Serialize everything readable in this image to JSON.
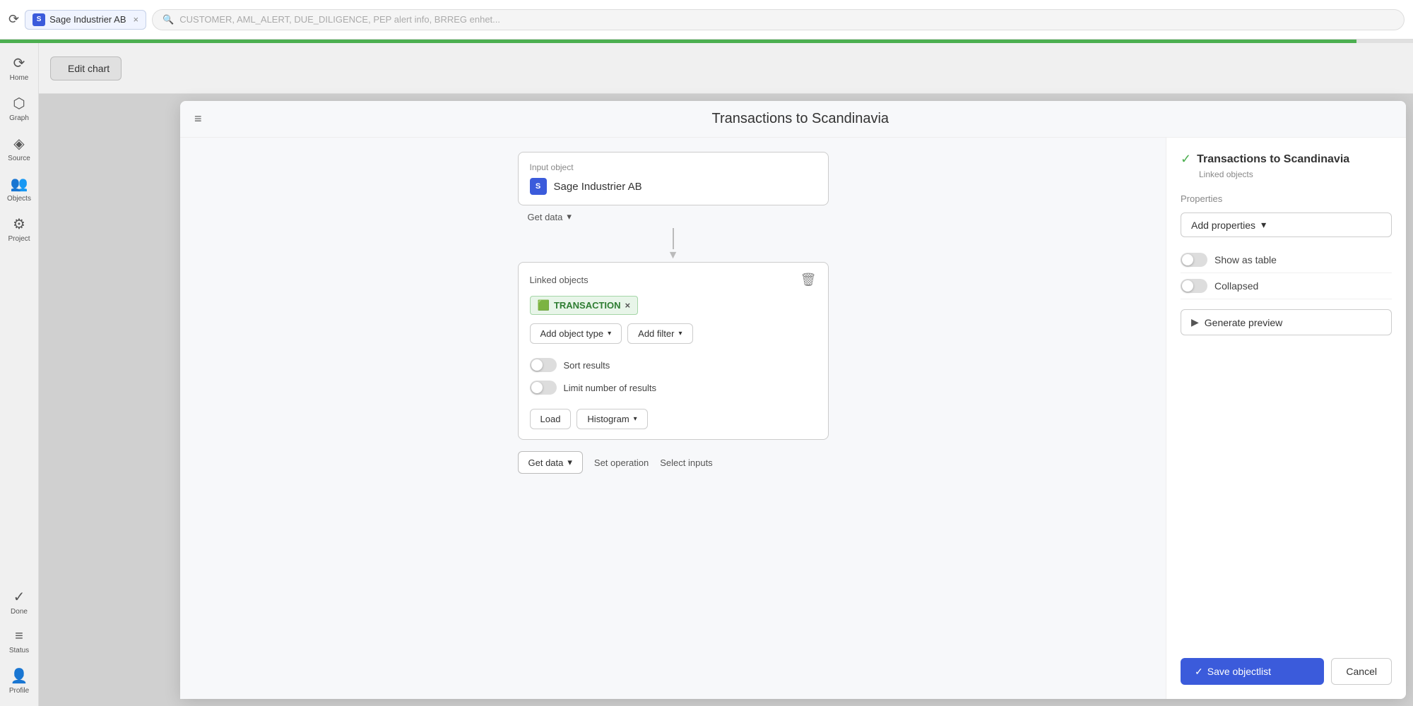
{
  "topbar": {
    "tab_title": "Sage Industrier AB",
    "tab_icon_text": "S",
    "search_placeholder": "CUSTOMER, AML_ALERT, DUE_DILIGENCE, PEP alert info, BRREG enhet..."
  },
  "sidebar": {
    "items": [
      {
        "id": "home",
        "label": "Home",
        "icon": "⟳"
      },
      {
        "id": "graph",
        "label": "Graph",
        "icon": "⬡"
      },
      {
        "id": "source",
        "label": "Source",
        "icon": "◈"
      },
      {
        "id": "objects",
        "label": "Objects",
        "icon": "👥"
      },
      {
        "id": "projects",
        "label": "Project",
        "icon": "⚙"
      },
      {
        "id": "done",
        "label": "Done",
        "icon": "✓"
      },
      {
        "id": "status",
        "label": "Status",
        "icon": "≡"
      },
      {
        "id": "profile",
        "label": "Profile",
        "icon": "👤"
      }
    ]
  },
  "edit_chart_bar": {
    "button_label": "Edit chart",
    "arrow_icon": "←"
  },
  "modal": {
    "title": "Transactions to Scandinavia",
    "menu_icon": "≡",
    "panel_title": "Transactions to Scandinavia",
    "panel_subtitle": "Linked objects",
    "properties_label": "Properties",
    "add_properties_label": "Add properties",
    "dropdown_arrow": "▾",
    "show_as_table_label": "Show as table",
    "collapsed_label": "Collapsed",
    "generate_preview_label": "Generate preview",
    "play_icon": "▶",
    "save_label": "Save objectlist",
    "check_icon": "✓",
    "cancel_label": "Cancel",
    "input_object_label": "Input object",
    "node_name": "Sage Industrier AB",
    "node_icon": "S",
    "get_data_label": "Get data",
    "linked_objects_label": "Linked objects",
    "transaction_tag": "TRANSACTION",
    "tag_close": "×",
    "add_object_type_label": "Add object type",
    "add_filter_label": "Add filter",
    "sort_results_label": "Sort results",
    "limit_results_label": "Limit number of results",
    "load_label": "Load",
    "histogram_label": "Histogram",
    "get_data2_label": "Get data",
    "set_operation_label": "Set operation",
    "select_inputs_label": "Select inputs",
    "delete_icon": "🗑",
    "bottom_text": "CUSTOMER, AML_ALERT, DUE_DILIGENCE, PEP alert info..."
  }
}
